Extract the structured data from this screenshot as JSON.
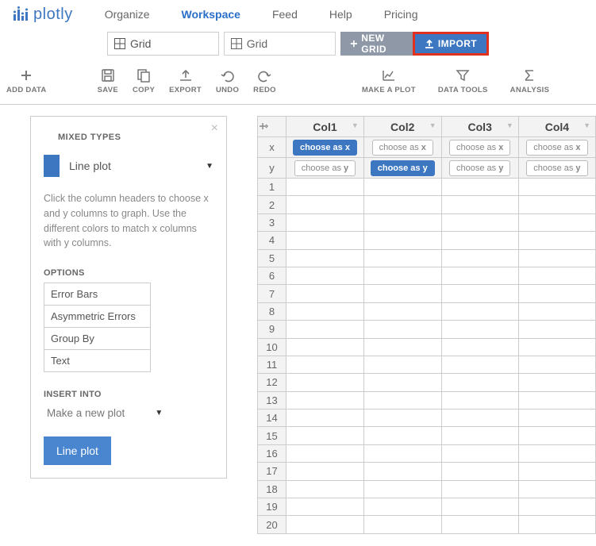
{
  "brand": "plotly",
  "nav": {
    "organize": "Organize",
    "workspace": "Workspace",
    "feed": "Feed",
    "help": "Help",
    "pricing": "Pricing"
  },
  "tabs": {
    "tab1": "Grid",
    "tab2": "Grid"
  },
  "buttons": {
    "new_grid": "NEW GRID",
    "import": "IMPORT"
  },
  "toolbar": {
    "add_data": "ADD DATA",
    "save": "SAVE",
    "copy": "COPY",
    "export": "EXPORT",
    "undo": "UNDO",
    "redo": "REDO",
    "make_plot": "MAKE A PLOT",
    "data_tools": "DATA TOOLS",
    "analysis": "ANALYSIS"
  },
  "panel": {
    "title": "MIXED TYPES",
    "plot_type": "Line plot",
    "help_text": "Click the column headers to choose x and y columns to graph. Use the different colors to match x columns with y columns.",
    "options_label": "OPTIONS",
    "options": [
      "Error Bars",
      "Asymmetric Errors",
      "Group By",
      "Text"
    ],
    "insert_label": "INSERT INTO",
    "insert_value": "Make a new plot",
    "submit": "Line plot"
  },
  "grid": {
    "columns": [
      "Col1",
      "Col2",
      "Col3",
      "Col4"
    ],
    "row_labels": [
      "x",
      "y"
    ],
    "choose_x": "choose as x",
    "choose_y": "choose as y",
    "x_selected_col": 0,
    "y_selected_col": 1,
    "row_count": 20
  }
}
